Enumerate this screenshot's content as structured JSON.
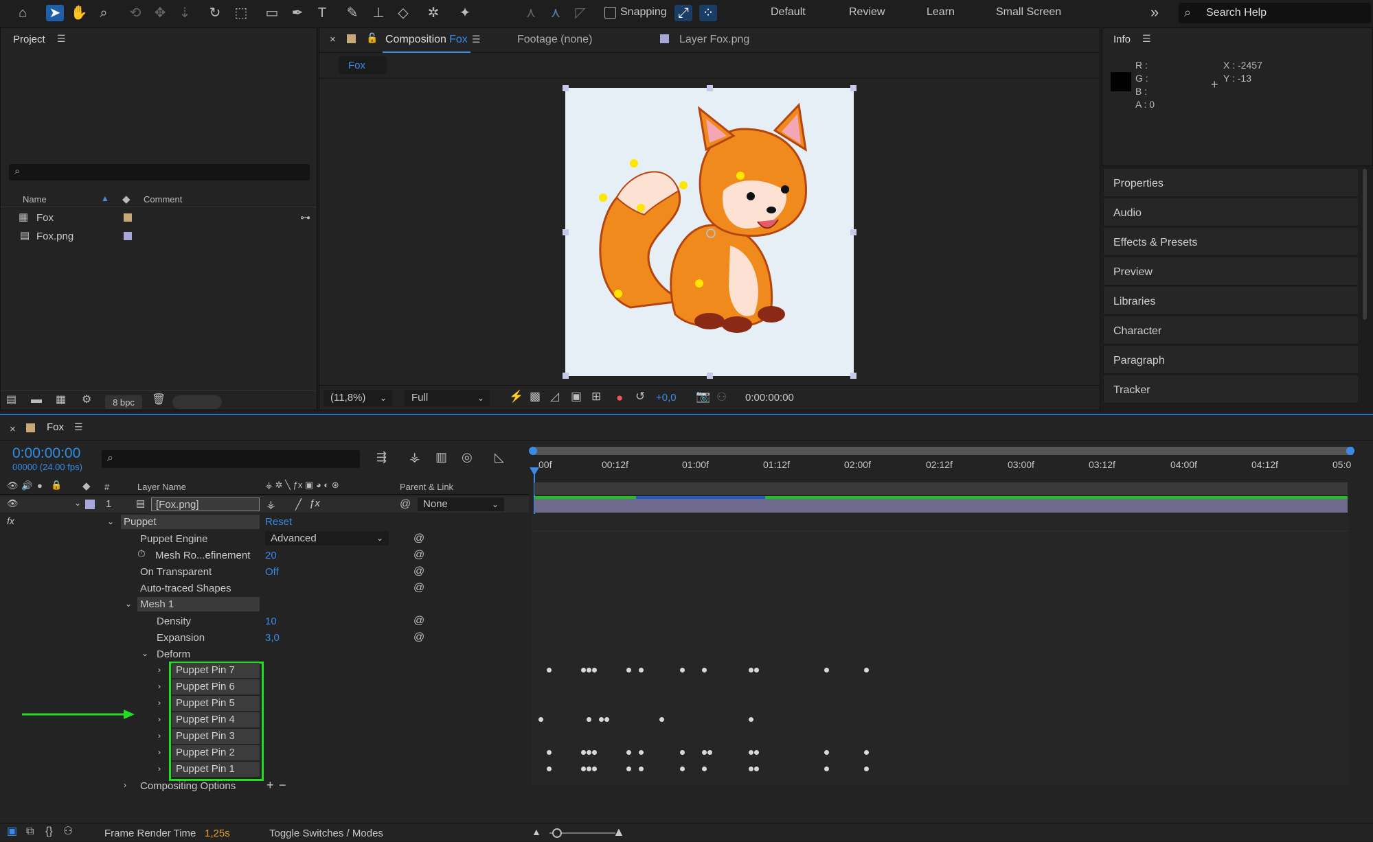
{
  "toolbar": {
    "snapping_label": "Snapping",
    "workspaces": [
      "Default",
      "Review",
      "Learn",
      "Small Screen"
    ],
    "search_placeholder": "Search Help",
    "more": "»"
  },
  "project": {
    "title": "Project",
    "columns": {
      "name": "Name",
      "comment": "Comment"
    },
    "items": [
      {
        "name": "Fox",
        "type": "composition",
        "color": "#c8a878"
      },
      {
        "name": "Fox.png",
        "type": "footage",
        "color": "#a8a8d8"
      }
    ],
    "bpc": "8 bpc"
  },
  "viewer": {
    "tabs": [
      {
        "label": "Composition",
        "highlight": "Fox"
      },
      {
        "label": "Footage (none)"
      },
      {
        "label": "Layer Fox.png"
      }
    ],
    "comp_button": "Fox",
    "zoom": "(11,8%)",
    "resolution": "Full",
    "exposure": "+0,0",
    "time": "0:00:00:00"
  },
  "info": {
    "title": "Info",
    "r": "R :",
    "g": "G :",
    "b": "B :",
    "a": "A : 0",
    "x": "X : -2457",
    "y": "Y : -13"
  },
  "side_panels": [
    "Properties",
    "Audio",
    "Effects & Presets",
    "Preview",
    "Libraries",
    "Character",
    "Paragraph",
    "Tracker"
  ],
  "timeline": {
    "comp_name": "Fox",
    "timecode": "0:00:00:00",
    "fps": "00000 (24.00 fps)",
    "col_num": "#",
    "col_layer": "Layer Name",
    "col_parent": "Parent & Link",
    "layer": {
      "num": "1",
      "name": "[Fox.png]",
      "parent": "None"
    },
    "ruler": [
      "00f",
      "00:12f",
      "01:00f",
      "01:12f",
      "02:00f",
      "02:12f",
      "03:00f",
      "03:12f",
      "04:00f",
      "04:12f",
      "05:0"
    ],
    "props": {
      "puppet": "Puppet",
      "reset": "Reset",
      "engine_label": "Puppet Engine",
      "engine_value": "Advanced",
      "mesh_ref_label": "Mesh Ro...efinement",
      "mesh_ref_value": "20",
      "on_trans_label": "On Transparent",
      "on_trans_value": "Off",
      "auto_label": "Auto-traced Shapes",
      "mesh1": "Mesh 1",
      "density_label": "Density",
      "density_value": "10",
      "expansion_label": "Expansion",
      "expansion_value": "3,0",
      "deform": "Deform",
      "pins": [
        "Puppet Pin 7",
        "Puppet Pin 6",
        "Puppet Pin 5",
        "Puppet Pin 4",
        "Puppet Pin 3",
        "Puppet Pin 2",
        "Puppet Pin 1"
      ],
      "compositing": "Compositing Options"
    },
    "footer": {
      "render_label": "Frame Render Time",
      "render_value": "1,25s",
      "toggle": "Toggle Switches / Modes"
    }
  },
  "colors": {
    "accent": "#3b8ae8",
    "highlight": "#22dd22",
    "timecode": "#2f8fe8",
    "render": "#e8a030"
  }
}
